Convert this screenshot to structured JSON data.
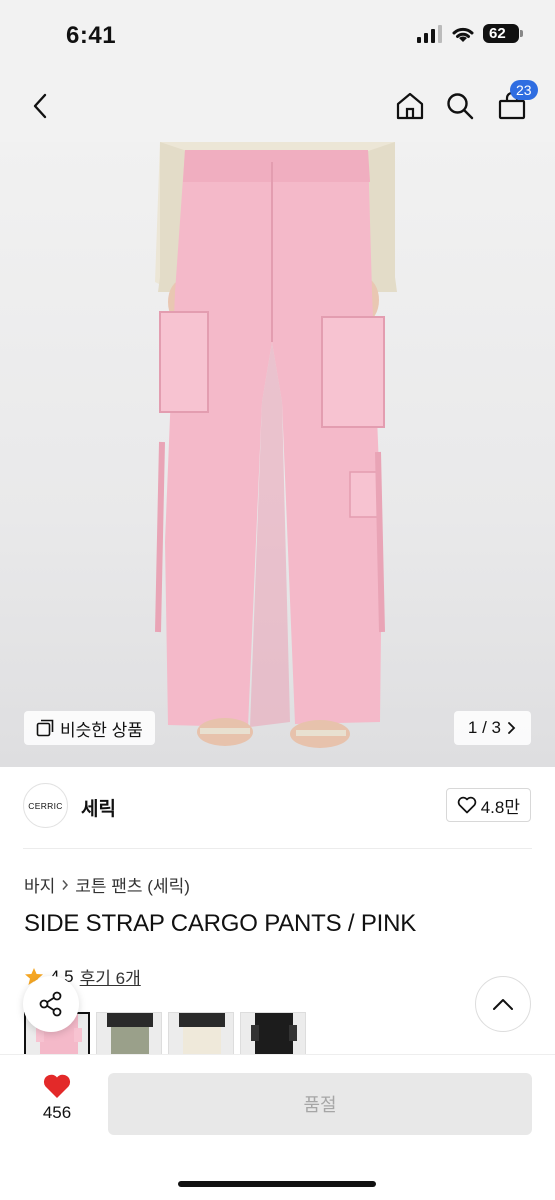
{
  "status": {
    "time": "6:41",
    "battery": "62"
  },
  "nav": {
    "cart_count": "23"
  },
  "hero": {
    "similar_label": "비슷한 상품",
    "page_counter": "1 / 3"
  },
  "brand": {
    "logo_text": "CERRIC",
    "name": "세릭",
    "likes": "4.8만"
  },
  "breadcrumb": {
    "level1": "바지",
    "level2": "코튼 팬츠 (세릭)"
  },
  "product": {
    "title": "SIDE STRAP CARGO PANTS / PINK",
    "rating": "4.5",
    "reviews": "후기 6개"
  },
  "bottom": {
    "like_count": "456",
    "buy_label": "품절"
  },
  "colors": {
    "accent": "#2f6de1",
    "heart": "#e32929",
    "pants": "#f4b9c9"
  }
}
